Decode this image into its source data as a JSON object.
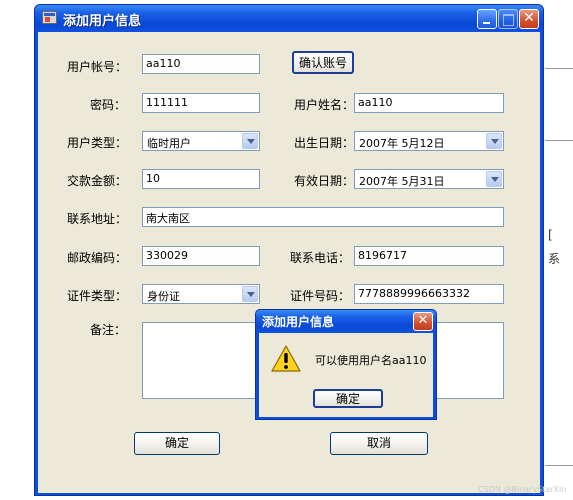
{
  "window": {
    "title": "添加用户信息",
    "minimize_glyph": "",
    "maximize_glyph": "",
    "close_glyph": "✕"
  },
  "form": {
    "account_label": "用户帐号：",
    "account_value": "aa110",
    "confirm_account_button": "确认账号",
    "password_label": "密码：",
    "password_value": "111111",
    "username_label": "用户姓名：",
    "username_value": "aa110",
    "usertype_label": "用户类型：",
    "usertype_value": "临时用户",
    "birth_label": "出生日期：",
    "birth_value": "2007年 5月12日",
    "payment_label": "交款金额：",
    "payment_value": "10",
    "valid_label": "有效日期：",
    "valid_value": "2007年 5月31日",
    "address_label": "联系地址：",
    "address_value": "南大南区",
    "postcode_label": "邮政编码：",
    "postcode_value": "330029",
    "phone_label": "联系电话：",
    "phone_value": "8196717",
    "idtype_label": "证件类型：",
    "idtype_value": "身份证",
    "idnumber_label": "证件号码：",
    "idnumber_value": "7778889996663332",
    "remark_label": "备注：",
    "ok_button": "确定",
    "cancel_button": "取消"
  },
  "dialog": {
    "title": "添加用户信息",
    "close_glyph": "✕",
    "message": "可以使用用户名aa110",
    "ok_button": "确定",
    "icon": "warning-icon"
  },
  "background": {
    "side_glyph_1": "[",
    "side_glyph_2": "系",
    "watermark": "CSDN @BinaryStarXin"
  },
  "colors": {
    "title_blue": "#0a48d6",
    "face": "#ece9d8",
    "field_border": "#7f9db9",
    "close_red": "#d2512d"
  }
}
